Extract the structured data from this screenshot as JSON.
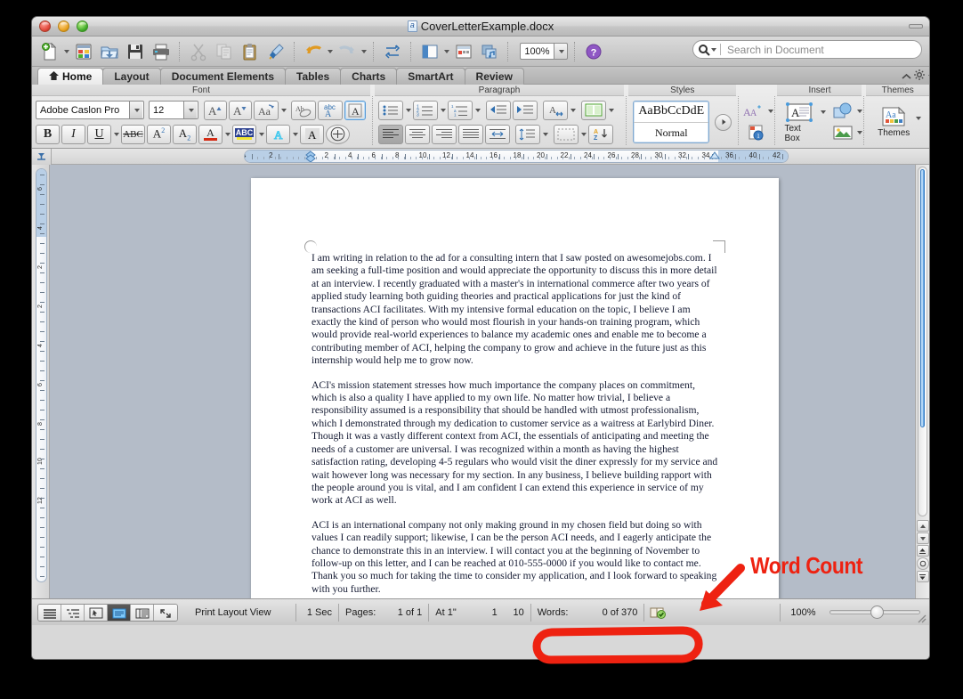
{
  "window": {
    "title": "CoverLetterExample.docx",
    "controls": {
      "close": "close-button",
      "minimize": "minimize-button",
      "maximize": "maximize-button"
    }
  },
  "toolbar": {
    "items": [
      {
        "name": "new-document",
        "label": "New"
      },
      {
        "name": "open-template-gallery",
        "label": "Template Gallery"
      },
      {
        "name": "open-document",
        "label": "Open"
      },
      {
        "name": "save-document",
        "label": "Save"
      },
      {
        "name": "print-document",
        "label": "Print"
      },
      {
        "name": "cut",
        "label": "Cut"
      },
      {
        "name": "copy",
        "label": "Copy"
      },
      {
        "name": "paste",
        "label": "Paste"
      },
      {
        "name": "format-painter",
        "label": "Format"
      },
      {
        "name": "undo",
        "label": "Undo"
      },
      {
        "name": "redo",
        "label": "Redo"
      },
      {
        "name": "show-formatting-marks",
        "label": "Show"
      },
      {
        "name": "sidebar-toggle",
        "label": "Sidebar"
      },
      {
        "name": "gallery",
        "label": "Gallery"
      },
      {
        "name": "media",
        "label": "Media"
      }
    ],
    "zoom_value": "100%",
    "help_label": "Help"
  },
  "search": {
    "placeholder": "Search in Document",
    "value": ""
  },
  "tabs": [
    {
      "label": "Home",
      "active": true
    },
    {
      "label": "Layout",
      "active": false
    },
    {
      "label": "Document Elements",
      "active": false
    },
    {
      "label": "Tables",
      "active": false
    },
    {
      "label": "Charts",
      "active": false
    },
    {
      "label": "SmartArt",
      "active": false
    },
    {
      "label": "Review",
      "active": false
    }
  ],
  "ribbon": {
    "groups": [
      {
        "name": "font",
        "label": "Font"
      },
      {
        "name": "paragraph",
        "label": "Paragraph"
      },
      {
        "name": "styles",
        "label": "Styles"
      },
      {
        "name": "insert",
        "label": "Insert"
      },
      {
        "name": "themes",
        "label": "Themes"
      }
    ],
    "font": {
      "family": "Adobe Caslon Pro",
      "size": "12",
      "buttons": [
        "grow-font",
        "shrink-font",
        "change-case",
        "clear-formatting",
        "text-effects",
        "text-highlight-box",
        "bold",
        "italic",
        "underline",
        "strikethrough",
        "superscript",
        "subscript",
        "font-color",
        "highlight-color",
        "text-glow",
        "text-shadow",
        "character-border"
      ]
    },
    "paragraph": {
      "buttons": [
        "bulleted-list",
        "numbered-list",
        "multilevel-list",
        "decrease-indent",
        "increase-indent",
        "line-spacing",
        "columns",
        "align-left",
        "align-center",
        "align-right",
        "justify",
        "text-direction",
        "paragraph-spacing",
        "borders",
        "sort"
      ]
    },
    "styles": {
      "preview_sample": "AaBbCcDdE",
      "preview_name": "Normal",
      "more_label": "More styles"
    },
    "insert": {
      "text_box_label": "Text Box",
      "buttons": [
        "text-box",
        "shapes",
        "picture",
        "wordart",
        "page-number"
      ]
    },
    "themes": {
      "label": "Themes"
    }
  },
  "ruler": {
    "horizontal_ticks": [
      "4",
      "2",
      "2",
      "4",
      "6",
      "8",
      "10",
      "12",
      "14",
      "16",
      "18",
      "20",
      "22",
      "24",
      "26",
      "28",
      "30",
      "32",
      "34",
      "36",
      "40",
      "42"
    ],
    "vertical_ticks": [
      "6",
      "4",
      "2",
      "2",
      "4",
      "6",
      "8",
      "10",
      "12"
    ]
  },
  "document": {
    "paragraphs": [
      "I am writing in relation to the ad for a consulting intern that I saw posted on awesomejobs.com. I am seeking a full-time position and would appreciate the opportunity to discuss this in more detail at an interview. I recently graduated with a master's in international commerce after two years of applied study learning both guiding theories and practical applications for just the kind of transactions ACI facilitates. With my intensive formal education on the topic, I believe I am exactly the kind of person who would most flourish in your hands-on training program, which would provide real-world experiences to balance my academic ones and enable me to become a contributing member of ACI, helping the company to grow and achieve in the future just as this internship would help me to grow now.",
      "ACI's mission statement stresses how much importance the company places on commitment, which is also a quality I have applied to my own life. No matter how trivial, I believe a responsibility assumed is a responsibility that should be handled with utmost professionalism, which I demonstrated through my dedication to customer service as a waitress at Earlybird Diner. Though it was a vastly different context from ACI, the essentials of anticipating and meeting the needs of a customer are universal. I was recognized within a month as having the highest satisfaction rating, developing 4-5 regulars who would visit the diner expressly for my service and wait however long was necessary for my section. In any business, I believe building rapport with the people around you is vital, and I am confident I can extend this experience in service of my work at ACI as well.",
      "ACI is an international company not only making ground in my chosen field but doing so with values I can readily support; likewise, I can be the person ACI needs, and I eagerly anticipate the chance to demonstrate this in an interview. I will contact you at the beginning of November to follow-up on this letter, and I can be reached at 010-555-0000 if you would like to contact me. Thank you so much for taking the time to consider my application, and I look forward to speaking with you further."
    ]
  },
  "statusbar": {
    "view_buttons": [
      {
        "name": "draft-view",
        "active": false
      },
      {
        "name": "outline-view",
        "active": false
      },
      {
        "name": "publishing-layout-view",
        "active": false
      },
      {
        "name": "print-layout-view",
        "active": true
      },
      {
        "name": "notebook-layout-view",
        "active": false
      },
      {
        "name": "full-screen-view",
        "active": false
      }
    ],
    "view_label": "Print Layout View",
    "sec_label": "1 Sec",
    "pages_label": "Pages:",
    "pages_value": "1 of 1",
    "at_label": "At 1\"",
    "line_value": "1",
    "col_value": "10",
    "words_label": "Words:",
    "words_value": "0 of 370",
    "spellcheck_name": "spelling-and-grammar-status",
    "zoom_value": "100%"
  },
  "annotations": {
    "label": "Word Count",
    "color": "#ee2211",
    "arrow_name": "red-arrow-annotation",
    "highlight_name": "red-highlight-oval"
  }
}
